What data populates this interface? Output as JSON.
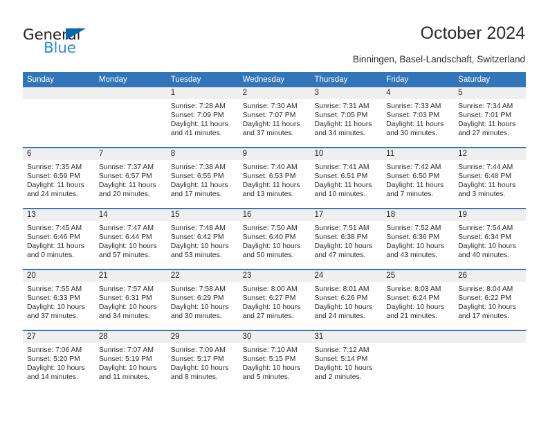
{
  "brand": {
    "name_primary": "General",
    "name_secondary": "Blue",
    "primary_color": "#231f20",
    "secondary_color": "#2e8bd4",
    "triangle_color": "#0a66ad"
  },
  "header": {
    "title": "October 2024",
    "subtitle": "Binningen, Basel-Landschaft, Switzerland",
    "header_bg_color": "#3275b8",
    "header_text_color": "#ffffff",
    "daystrip_bg_color": "#efefef"
  },
  "weekday_headers": [
    "Sunday",
    "Monday",
    "Tuesday",
    "Wednesday",
    "Thursday",
    "Friday",
    "Saturday"
  ],
  "weeks": [
    {
      "days": [
        {
          "date": "",
          "lines": []
        },
        {
          "date": "",
          "lines": []
        },
        {
          "date": "1",
          "lines": [
            "Sunrise: 7:28 AM",
            "Sunset: 7:09 PM",
            "Daylight: 11 hours",
            "and 41 minutes."
          ]
        },
        {
          "date": "2",
          "lines": [
            "Sunrise: 7:30 AM",
            "Sunset: 7:07 PM",
            "Daylight: 11 hours",
            "and 37 minutes."
          ]
        },
        {
          "date": "3",
          "lines": [
            "Sunrise: 7:31 AM",
            "Sunset: 7:05 PM",
            "Daylight: 11 hours",
            "and 34 minutes."
          ]
        },
        {
          "date": "4",
          "lines": [
            "Sunrise: 7:33 AM",
            "Sunset: 7:03 PM",
            "Daylight: 11 hours",
            "and 30 minutes."
          ]
        },
        {
          "date": "5",
          "lines": [
            "Sunrise: 7:34 AM",
            "Sunset: 7:01 PM",
            "Daylight: 11 hours",
            "and 27 minutes."
          ]
        }
      ]
    },
    {
      "days": [
        {
          "date": "6",
          "lines": [
            "Sunrise: 7:35 AM",
            "Sunset: 6:59 PM",
            "Daylight: 11 hours",
            "and 24 minutes."
          ]
        },
        {
          "date": "7",
          "lines": [
            "Sunrise: 7:37 AM",
            "Sunset: 6:57 PM",
            "Daylight: 11 hours",
            "and 20 minutes."
          ]
        },
        {
          "date": "8",
          "lines": [
            "Sunrise: 7:38 AM",
            "Sunset: 6:55 PM",
            "Daylight: 11 hours",
            "and 17 minutes."
          ]
        },
        {
          "date": "9",
          "lines": [
            "Sunrise: 7:40 AM",
            "Sunset: 6:53 PM",
            "Daylight: 11 hours",
            "and 13 minutes."
          ]
        },
        {
          "date": "10",
          "lines": [
            "Sunrise: 7:41 AM",
            "Sunset: 6:51 PM",
            "Daylight: 11 hours",
            "and 10 minutes."
          ]
        },
        {
          "date": "11",
          "lines": [
            "Sunrise: 7:42 AM",
            "Sunset: 6:50 PM",
            "Daylight: 11 hours",
            "and 7 minutes."
          ]
        },
        {
          "date": "12",
          "lines": [
            "Sunrise: 7:44 AM",
            "Sunset: 6:48 PM",
            "Daylight: 11 hours",
            "and 3 minutes."
          ]
        }
      ]
    },
    {
      "days": [
        {
          "date": "13",
          "lines": [
            "Sunrise: 7:45 AM",
            "Sunset: 6:46 PM",
            "Daylight: 11 hours",
            "and 0 minutes."
          ]
        },
        {
          "date": "14",
          "lines": [
            "Sunrise: 7:47 AM",
            "Sunset: 6:44 PM",
            "Daylight: 10 hours",
            "and 57 minutes."
          ]
        },
        {
          "date": "15",
          "lines": [
            "Sunrise: 7:48 AM",
            "Sunset: 6:42 PM",
            "Daylight: 10 hours",
            "and 53 minutes."
          ]
        },
        {
          "date": "16",
          "lines": [
            "Sunrise: 7:50 AM",
            "Sunset: 6:40 PM",
            "Daylight: 10 hours",
            "and 50 minutes."
          ]
        },
        {
          "date": "17",
          "lines": [
            "Sunrise: 7:51 AM",
            "Sunset: 6:38 PM",
            "Daylight: 10 hours",
            "and 47 minutes."
          ]
        },
        {
          "date": "18",
          "lines": [
            "Sunrise: 7:52 AM",
            "Sunset: 6:36 PM",
            "Daylight: 10 hours",
            "and 43 minutes."
          ]
        },
        {
          "date": "19",
          "lines": [
            "Sunrise: 7:54 AM",
            "Sunset: 6:34 PM",
            "Daylight: 10 hours",
            "and 40 minutes."
          ]
        }
      ]
    },
    {
      "days": [
        {
          "date": "20",
          "lines": [
            "Sunrise: 7:55 AM",
            "Sunset: 6:33 PM",
            "Daylight: 10 hours",
            "and 37 minutes."
          ]
        },
        {
          "date": "21",
          "lines": [
            "Sunrise: 7:57 AM",
            "Sunset: 6:31 PM",
            "Daylight: 10 hours",
            "and 34 minutes."
          ]
        },
        {
          "date": "22",
          "lines": [
            "Sunrise: 7:58 AM",
            "Sunset: 6:29 PM",
            "Daylight: 10 hours",
            "and 30 minutes."
          ]
        },
        {
          "date": "23",
          "lines": [
            "Sunrise: 8:00 AM",
            "Sunset: 6:27 PM",
            "Daylight: 10 hours",
            "and 27 minutes."
          ]
        },
        {
          "date": "24",
          "lines": [
            "Sunrise: 8:01 AM",
            "Sunset: 6:26 PM",
            "Daylight: 10 hours",
            "and 24 minutes."
          ]
        },
        {
          "date": "25",
          "lines": [
            "Sunrise: 8:03 AM",
            "Sunset: 6:24 PM",
            "Daylight: 10 hours",
            "and 21 minutes."
          ]
        },
        {
          "date": "26",
          "lines": [
            "Sunrise: 8:04 AM",
            "Sunset: 6:22 PM",
            "Daylight: 10 hours",
            "and 17 minutes."
          ]
        }
      ]
    },
    {
      "days": [
        {
          "date": "27",
          "lines": [
            "Sunrise: 7:06 AM",
            "Sunset: 5:20 PM",
            "Daylight: 10 hours",
            "and 14 minutes."
          ]
        },
        {
          "date": "28",
          "lines": [
            "Sunrise: 7:07 AM",
            "Sunset: 5:19 PM",
            "Daylight: 10 hours",
            "and 11 minutes."
          ]
        },
        {
          "date": "29",
          "lines": [
            "Sunrise: 7:09 AM",
            "Sunset: 5:17 PM",
            "Daylight: 10 hours",
            "and 8 minutes."
          ]
        },
        {
          "date": "30",
          "lines": [
            "Sunrise: 7:10 AM",
            "Sunset: 5:15 PM",
            "Daylight: 10 hours",
            "and 5 minutes."
          ]
        },
        {
          "date": "31",
          "lines": [
            "Sunrise: 7:12 AM",
            "Sunset: 5:14 PM",
            "Daylight: 10 hours",
            "and 2 minutes."
          ]
        },
        {
          "date": "",
          "lines": []
        },
        {
          "date": "",
          "lines": []
        }
      ]
    }
  ]
}
